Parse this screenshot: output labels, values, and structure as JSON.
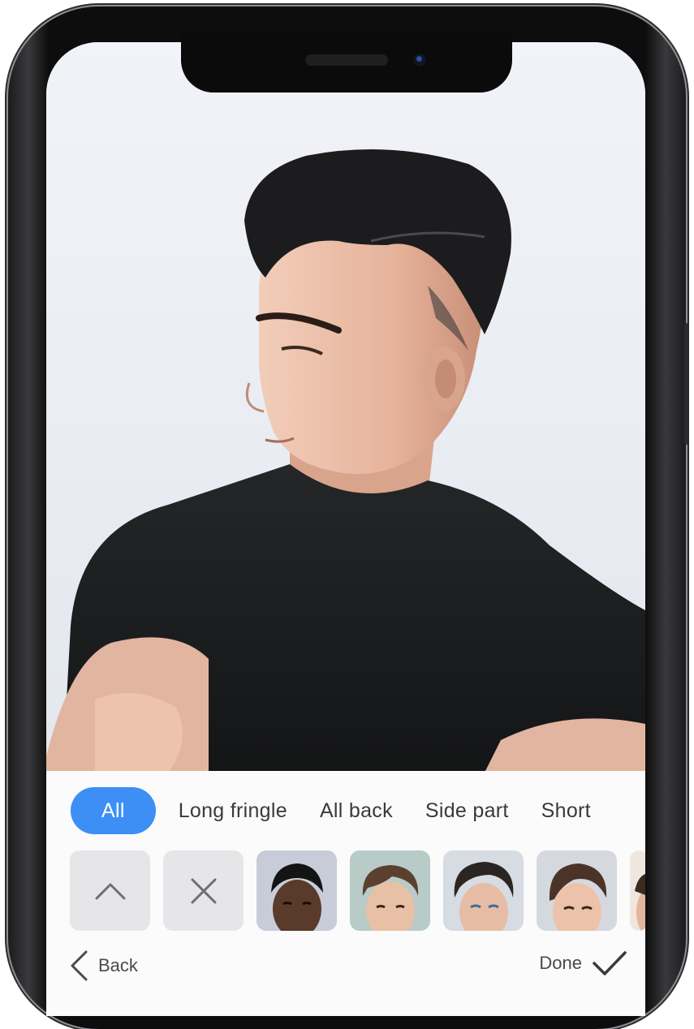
{
  "categories": {
    "tabs": [
      {
        "label": "All",
        "active": true
      },
      {
        "label": "Long fringle",
        "active": false
      },
      {
        "label": "All back",
        "active": false
      },
      {
        "label": "Side part",
        "active": false
      },
      {
        "label": "Short",
        "active": false
      }
    ]
  },
  "tools": {
    "expand_icon": "chevron-up-icon",
    "remove_icon": "close-icon"
  },
  "styles": {
    "thumbnails": [
      "hairstyle-1",
      "hairstyle-2",
      "hairstyle-3",
      "hairstyle-4"
    ]
  },
  "nav": {
    "back_label": "Back",
    "done_label": "Done"
  },
  "colors": {
    "accent": "#3d8ff6",
    "sheet_bg": "#fbfbfc",
    "tool_bg": "#e6e6e8"
  }
}
